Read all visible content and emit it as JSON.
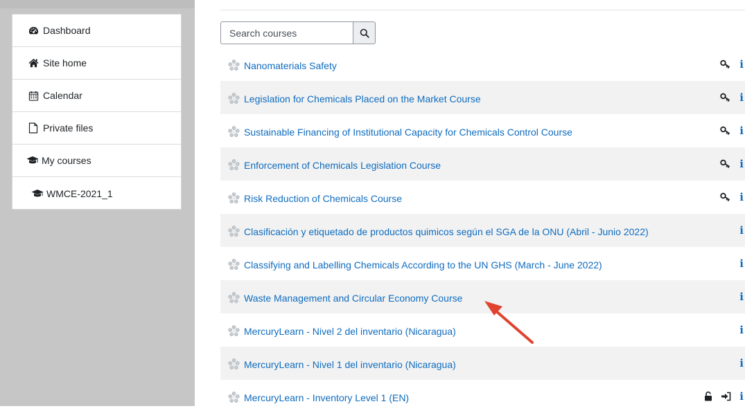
{
  "nav": {
    "items": [
      {
        "label": "Dashboard",
        "icon": "dashboard-icon"
      },
      {
        "label": "Site home",
        "icon": "home-icon"
      },
      {
        "label": "Calendar",
        "icon": "calendar-icon"
      },
      {
        "label": "Private files",
        "icon": "file-icon"
      },
      {
        "label": "My courses",
        "icon": "graduation-cap-icon"
      },
      {
        "label": "WMCE-2021_1",
        "icon": "graduation-cap-icon"
      }
    ]
  },
  "search": {
    "placeholder": "Search courses",
    "button_icon": "search-icon"
  },
  "courses": [
    {
      "title": "Nanomaterials Safety",
      "icons": [
        "key-icon",
        "info-icon"
      ]
    },
    {
      "title": "Legislation for Chemicals Placed on the Market Course",
      "icons": [
        "key-icon",
        "info-icon"
      ]
    },
    {
      "title": "Sustainable Financing of Institutional Capacity for Chemicals Control Course",
      "icons": [
        "key-icon",
        "info-icon"
      ]
    },
    {
      "title": "Enforcement of Chemicals Legislation Course",
      "icons": [
        "key-icon",
        "info-icon"
      ]
    },
    {
      "title": "Risk Reduction of Chemicals Course",
      "icons": [
        "key-icon",
        "info-icon"
      ]
    },
    {
      "title": "Clasificación y etiquetado de productos quimicos según el SGA de la ONU (Abril - Junio 2022)",
      "icons": [
        "info-icon"
      ]
    },
    {
      "title": "Classifying and Labelling Chemicals According to the UN GHS (March - June 2022)",
      "icons": [
        "info-icon"
      ]
    },
    {
      "title": "Waste Management and Circular Economy Course",
      "icons": [
        "info-icon"
      ]
    },
    {
      "title": "MercuryLearn - Nivel 2 del inventario (Nicaragua)",
      "icons": [
        "info-icon"
      ]
    },
    {
      "title": "MercuryLearn - Nivel 1 del inventario (Nicaragua)",
      "icons": [
        "info-icon"
      ]
    },
    {
      "title": "MercuryLearn - Inventory Level 1 (EN)",
      "icons": [
        "unlock-icon",
        "enrol-icon",
        "info-icon"
      ]
    }
  ],
  "colors": {
    "link": "#0f6cbf",
    "annotation_arrow": "#e0432f",
    "sidebar_bg": "#c6c6c6",
    "row_alt_bg": "#f2f2f2"
  },
  "info_glyph": "i"
}
